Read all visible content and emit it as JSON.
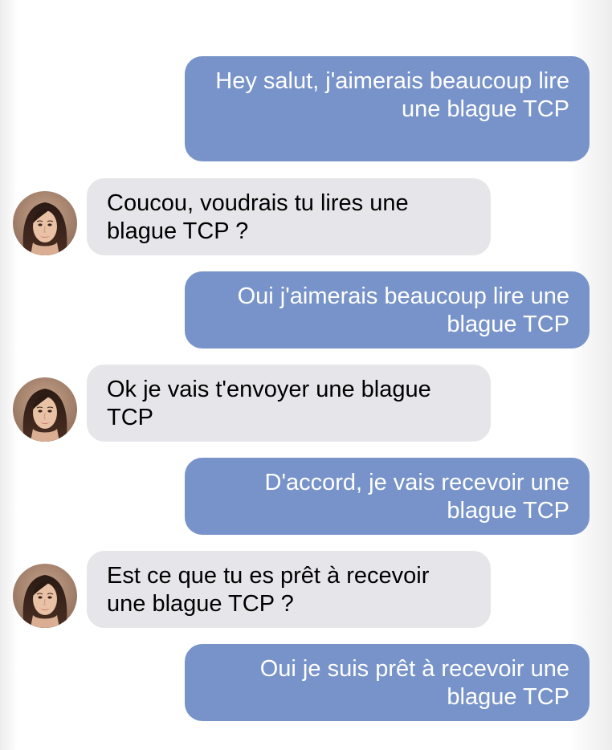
{
  "colors": {
    "sent_bubble": "#7793c9",
    "received_bubble": "#e6e6ea",
    "sent_text": "#ffffff",
    "received_text": "#000000"
  },
  "contact": {
    "avatar_icon": "contact-avatar"
  },
  "messages": [
    {
      "sender": "me",
      "text": "Hey salut, j'aimerais beaucoup lire une blague TCP"
    },
    {
      "sender": "contact",
      "text": "Coucou, voudrais tu lires une blague TCP ?"
    },
    {
      "sender": "me",
      "text": "Oui j'aimerais beaucoup lire une blague TCP"
    },
    {
      "sender": "contact",
      "text": "Ok je vais t'envoyer une blague TCP"
    },
    {
      "sender": "me",
      "text": "D'accord, je vais recevoir une blague TCP"
    },
    {
      "sender": "contact",
      "text": "Est ce que tu es prêt à recevoir une blague TCP ?"
    },
    {
      "sender": "me",
      "text": "Oui je suis prêt à recevoir une blague TCP"
    }
  ]
}
